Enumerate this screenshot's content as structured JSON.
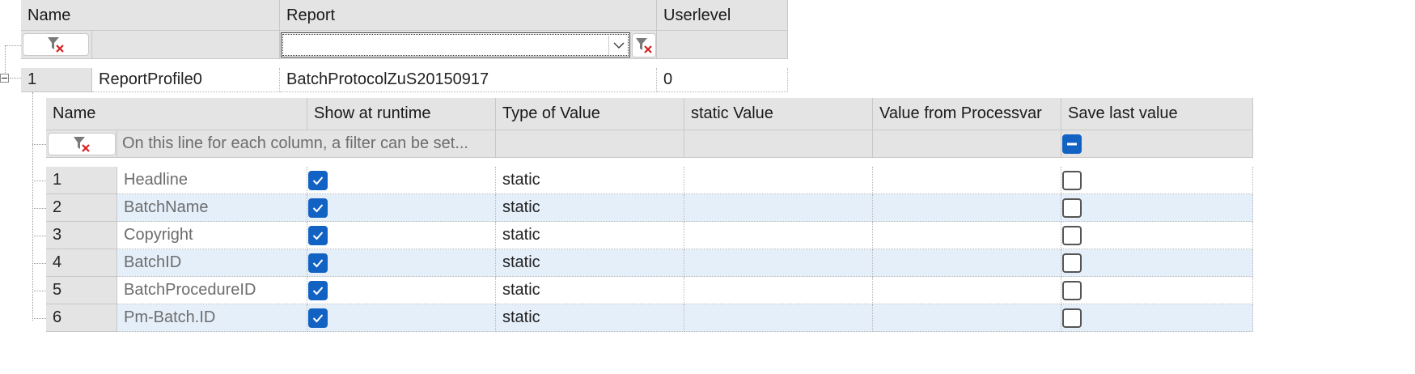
{
  "outer_grid": {
    "headers": {
      "name": "Name",
      "report": "Report",
      "userlevel": "Userlevel"
    },
    "filter": {
      "report_value": ""
    },
    "row": {
      "num": "1",
      "name": "ReportProfile0",
      "report": "BatchProtocolZuS20150917",
      "userlevel": "0"
    }
  },
  "inner_grid": {
    "headers": {
      "name": "Name",
      "show_at_runtime": "Show at runtime",
      "type_of_value": "Type of Value",
      "static_value": "static Value",
      "value_from_processvar": "Value from Processvar",
      "save_last_value": "Save last value"
    },
    "filter_hint": "On this line for each column, a filter can be set...",
    "rows": [
      {
        "num": "1",
        "name": "Headline",
        "show": true,
        "type": "static",
        "static_value": "",
        "processvar": "",
        "save": false
      },
      {
        "num": "2",
        "name": "BatchName",
        "show": true,
        "type": "static",
        "static_value": "",
        "processvar": "",
        "save": false
      },
      {
        "num": "3",
        "name": "Copyright",
        "show": true,
        "type": "static",
        "static_value": "",
        "processvar": "",
        "save": false
      },
      {
        "num": "4",
        "name": "BatchID",
        "show": true,
        "type": "static",
        "static_value": "",
        "processvar": "",
        "save": false
      },
      {
        "num": "5",
        "name": "BatchProcedureID",
        "show": true,
        "type": "static",
        "static_value": "",
        "processvar": "",
        "save": false
      },
      {
        "num": "6",
        "name": "Pm-Batch.ID",
        "show": true,
        "type": "static",
        "static_value": "",
        "processvar": "",
        "save": false
      }
    ]
  },
  "icons": {
    "clear_filter": "filter-clear-icon",
    "dropdown": "chevron-down-icon",
    "collapse": "tree-collapse-icon",
    "checkbox_checked": "checkmark-icon",
    "checkbox_indeterminate": "minus-icon"
  },
  "colors": {
    "header_bg": "#e4e4e4",
    "alt_row_bg": "#e5effa",
    "checkbox_blue": "#1262c4",
    "filter_x_red": "#d42020"
  }
}
